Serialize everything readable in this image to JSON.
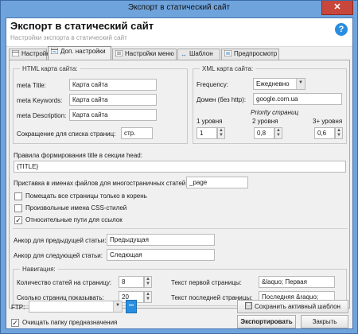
{
  "window": {
    "title": "Экспорт в статический сайт",
    "close_glyph": "✕"
  },
  "header": {
    "title": "Экспорт в статический сайт",
    "subtitle": "Настройки экспорта в статический сайт",
    "help_glyph": "?"
  },
  "tabs": [
    {
      "label": "Настройки",
      "icon": "settings-icon"
    },
    {
      "label": "Доп. настройки",
      "icon": "advanced-settings-icon",
      "active": true
    },
    {
      "label": "Настройки меню",
      "icon": "menu-icon"
    },
    {
      "label": "Шаблон",
      "icon": "template-icon"
    },
    {
      "label": "Предпросмотр",
      "icon": "preview-icon"
    }
  ],
  "html_map": {
    "title": "HTML карта сайта:",
    "meta_title_label": "meta Title:",
    "meta_title_value": "Карта сайта",
    "meta_keywords_label": "meta Keywords:",
    "meta_keywords_value": "Карта сайта",
    "meta_description_label": "meta Description:",
    "meta_description_value": "Карта сайта",
    "page_list_label": "Сокращение для списка страниц:",
    "page_list_value": "стр."
  },
  "xml_map": {
    "title": "XML карта сайта:",
    "frequency_label": "Frequency:",
    "frequency_value": "Ежедневно",
    "domain_label": "Домен (без http):",
    "domain_value": "google.com.ua",
    "priority_label": "Priority страниц",
    "levels": [
      {
        "label": "1 уровня",
        "value": "1"
      },
      {
        "label": "2 уровня",
        "value": "0,8"
      },
      {
        "label": "3+ уровня",
        "value": "0,6"
      }
    ]
  },
  "title_rule": {
    "label": "Правила формирования title в секции head:",
    "value": "{TITLE}"
  },
  "suffix": {
    "label": "Приставка в именах файлов для многостраничных статей:",
    "value": "_page"
  },
  "checkboxes": [
    {
      "label": "Помещать все страницы только в корень",
      "checked": false
    },
    {
      "label": "Произвольные имена CSS-стилей",
      "checked": false
    },
    {
      "label": "Относительные пути для ссылок",
      "checked": true,
      "mark": "✓"
    }
  ],
  "anchors": {
    "prev_label": "Анкор для предыдущей статьи:",
    "prev_value": "Предыдущая",
    "next_label": "Анкор для следующей статьи:",
    "next_value": "Следющая"
  },
  "navigation": {
    "title": "Навигация:",
    "count_label": "Количество статей на страницу:",
    "count_value": "8",
    "pages_label": "Сколько страниц показывать:",
    "pages_value": "20",
    "first_label": "Текст первой страницы:",
    "first_value": "&laquo; Первая",
    "last_label": "Текст последней страницы:",
    "last_value": "Последняя &raquo;"
  },
  "footer": {
    "ftp_label": "FTP:",
    "ftp_value": "",
    "clear_label": "Очищать папку предназначения",
    "clear_checked": true,
    "clear_mark": "✓",
    "save_template_label": "Сохранить активный шаблон",
    "export_label": "Экспортировать",
    "close_label": "Закрыть",
    "more_glyph": "•••"
  },
  "icon_glyphs": {
    "spin_up": "▲",
    "spin_down": "▼",
    "dropdown": "▼"
  },
  "colors": {
    "titlebar": "#6fa3dc",
    "close": "#c7473c",
    "accent": "#2a8ee0"
  }
}
